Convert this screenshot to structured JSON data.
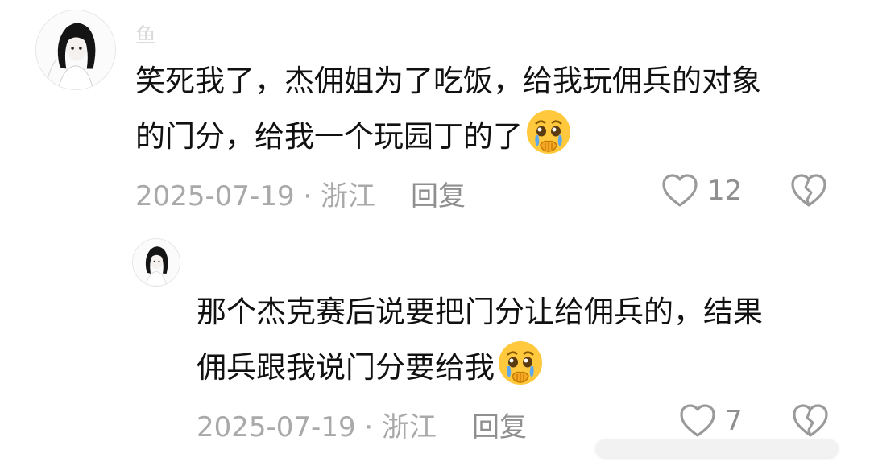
{
  "main_comment": {
    "username": "鱼",
    "text_lines": [
      "笑死我了，杰佣姐为了吃饭，给我玩佣兵的对象",
      "的门分，给我一个玩园丁的了"
    ],
    "emoji": "crying-face-emoji",
    "date": "2025-07-19",
    "separator": " · ",
    "location": "浙江",
    "reply_label": "回复",
    "like_count": "12"
  },
  "reply_comment": {
    "text_lines": [
      "那个杰克赛后说要把门分让给佣兵的，结果",
      "佣兵跟我说门分要给我"
    ],
    "emoji": "crying-face-emoji",
    "date": "2025-07-19",
    "separator": " · ",
    "location": "浙江",
    "reply_label": "回复",
    "like_count": "7"
  },
  "icons": {
    "like": "heart-outline-icon",
    "dislike": "broken-heart-icon"
  },
  "colors": {
    "text": "#111111",
    "meta": "#a9a9a9",
    "icon": "#9a9a9a",
    "emoji": "#ffc83d"
  }
}
